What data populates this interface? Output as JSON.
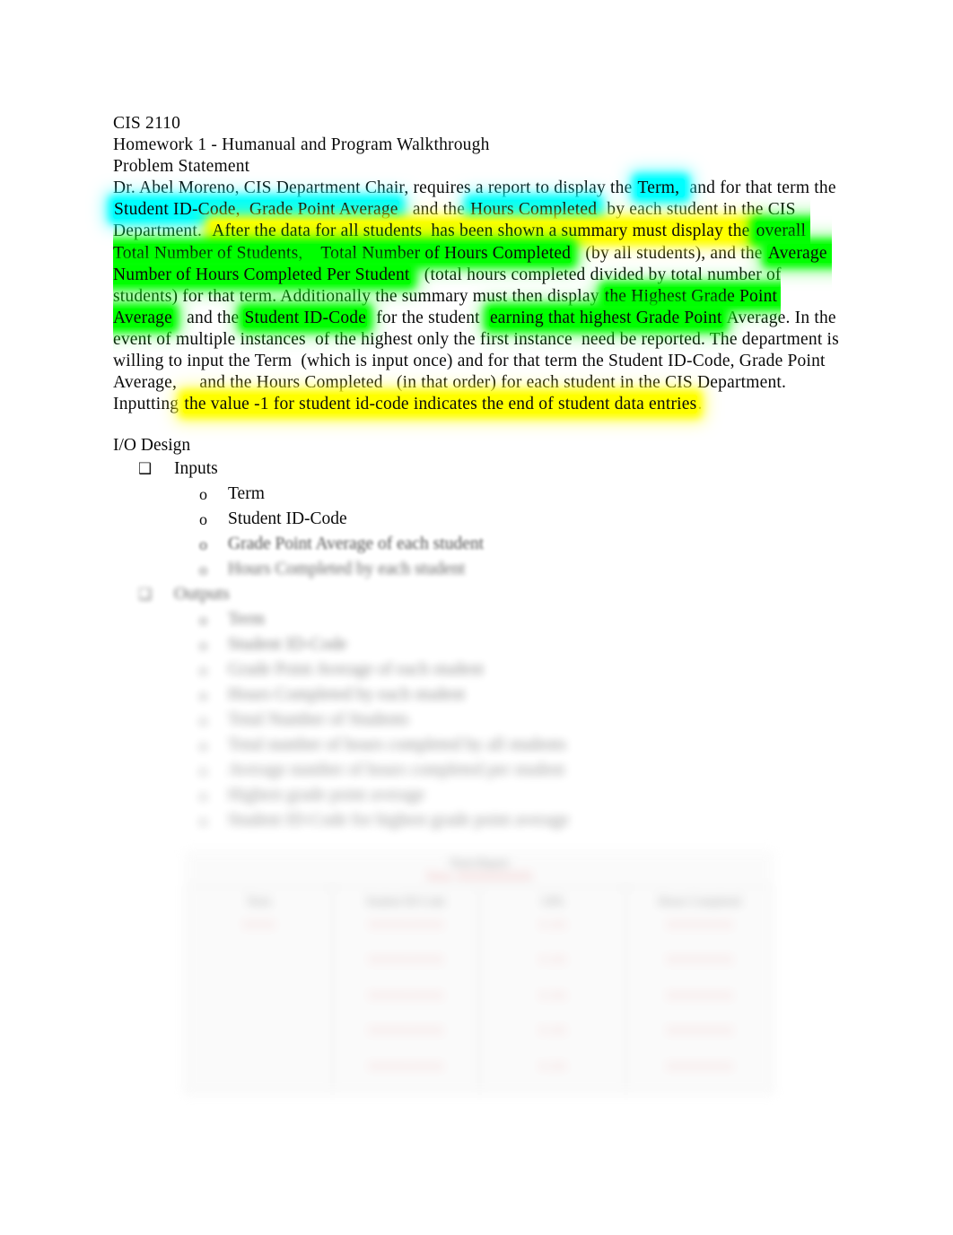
{
  "document": {
    "course": "CIS 2110",
    "assignment": "Homework 1 - Humanual and Program Walkthrough",
    "section_heading": "Problem Statement",
    "problem_statement": {
      "runs": [
        {
          "text": "Dr. Abel Moreno, CIS Department Chair, requires a report to display the ",
          "hl": "none"
        },
        {
          "text": "Term, ",
          "hl": "cyan"
        },
        {
          "text": " and for that term the ",
          "hl": "none"
        },
        {
          "text": "Student ID-Code,  Grade Point Average",
          "hl": "cyan"
        },
        {
          "text": "   and the ",
          "hl": "none"
        },
        {
          "text": "Hours Completed",
          "hl": "cyan"
        },
        {
          "text": "  by each student in the CIS Department.  ",
          "hl": "none"
        },
        {
          "text": "After the data for all students  has been shown a summary must display the ",
          "hl": "yellow"
        },
        {
          "text": "overall Total Number of Students,    Total Number of Hours Completed",
          "hl": "green"
        },
        {
          "text": "   (by all students), and the ",
          "hl": "none"
        },
        {
          "text": "Average Number of Hours Completed Per Student",
          "hl": "green"
        },
        {
          "text": "   (total hours completed divided by total number of students) for that term. Additionally the summary must then display ",
          "hl": "none"
        },
        {
          "text": "the Highest Grade Point Average",
          "hl": "green"
        },
        {
          "text": "   and the ",
          "hl": "none"
        },
        {
          "text": "Student ID-Code",
          "hl": "green"
        },
        {
          "text": "  for the student  ",
          "hl": "none"
        },
        {
          "text": "earning that highest Grade Point",
          "hl": "green"
        },
        {
          "text": " Average. In the event of multiple instances  of the highest only the first instance  need be reported. The department is willing to input the Term  (which is input once) and for that term the Student ID-Code, Grade Point Average,     and the Hours Completed   (in that order) for each student in the CIS Department. Inputting ",
          "hl": "none"
        },
        {
          "text": "the value -1 for student id-code indicates the end of student data entries",
          "hl": "yellow"
        },
        {
          "text": ".",
          "hl": "none"
        }
      ],
      "plain": "Dr. Abel Moreno, CIS Department Chair, requires a report to display the Term,  and for that term the Student ID-Code,  Grade Point Average   and the Hours Completed  by each student in the CIS Department.  After the data for all students  has been shown a summary must display the overall Total Number of Students,    Total Number of Hours Completed   (by all students), and the Average Number of Hours Completed Per Student   (total hours completed divided by total number of students) for that term. Additionally the summary must then display the Highest Grade Point Average   and the Student ID-Code  for the student  earning that highest Grade Point Average. In the event of multiple instances  of the highest only the first instance  need be reported. The department is willing to input the Term  (which is input once) and for that term the Student ID-Code, Grade Point Average,     and the Hours Completed   (in that order) for each student in the CIS Department. Inputting the value -1 for student id-code indicates the end of student data entries."
    },
    "io_design": {
      "heading": "I/O Design",
      "inputs": {
        "bullet": "❑",
        "label": "Inputs",
        "items": [
          {
            "bullet": "o",
            "label": "Term",
            "blur": 0
          },
          {
            "bullet": "o",
            "label": "Student ID-Code",
            "blur": 0
          },
          {
            "bullet": "o",
            "label": "Grade Point Average of each student",
            "blur": 1
          },
          {
            "bullet": "o",
            "label": "Hours Completed by each student",
            "blur": 2
          }
        ]
      },
      "outputs": {
        "bullet": "❑",
        "label": "Outputs",
        "items": [
          {
            "bullet": "o",
            "label": "Term",
            "blur": 3
          },
          {
            "bullet": "o",
            "label": "Student ID-Code",
            "blur": 4
          },
          {
            "bullet": "o",
            "label": "Grade Point Average of each student",
            "blur": 5
          },
          {
            "bullet": "o",
            "label": "Hours Completed by each student",
            "blur": 5
          },
          {
            "bullet": "o",
            "label": "Total Number of Students",
            "blur": 6
          },
          {
            "bullet": "o",
            "label": "Total number of hours completed by all students",
            "blur": 6
          },
          {
            "bullet": "o",
            "label": "Average number of hours completed per student",
            "blur": 7
          },
          {
            "bullet": "o",
            "label": "Highest grade point average",
            "blur": 7
          },
          {
            "bullet": "o",
            "label": "Student ID-Code for highest grade point average",
            "blur": 7
          }
        ]
      }
    },
    "table": {
      "caption_lines": [
        "Term Report",
        "Term: XXXXXXXXX"
      ],
      "headers": [
        "Term",
        "Student ID-Code",
        "GPA",
        "Hours Completed"
      ],
      "rows": [
        [
          "XXXX",
          "XXXXXXXXX",
          "X.XX",
          "XXXXXXXX"
        ],
        [
          "",
          "XXXXXXXXX",
          "X.XX",
          "XXXXXXXX"
        ],
        [
          "",
          "XXXXXXXXX",
          "X.XX",
          "XXXXXXXX"
        ],
        [
          "",
          "XXXXXXXXX",
          "X.XX",
          "XXXXXXXX"
        ],
        [
          "",
          "XXXXXXXXX",
          "X.XX",
          "XXXXXXXX"
        ]
      ]
    },
    "colors": {
      "highlight_cyan": "#00ffff",
      "highlight_yellow": "#ffff00",
      "highlight_green": "#00ff00",
      "table_accent_red": "#e8a5a5",
      "page_background": "#ffffff",
      "text": "#0a0a0a"
    }
  }
}
